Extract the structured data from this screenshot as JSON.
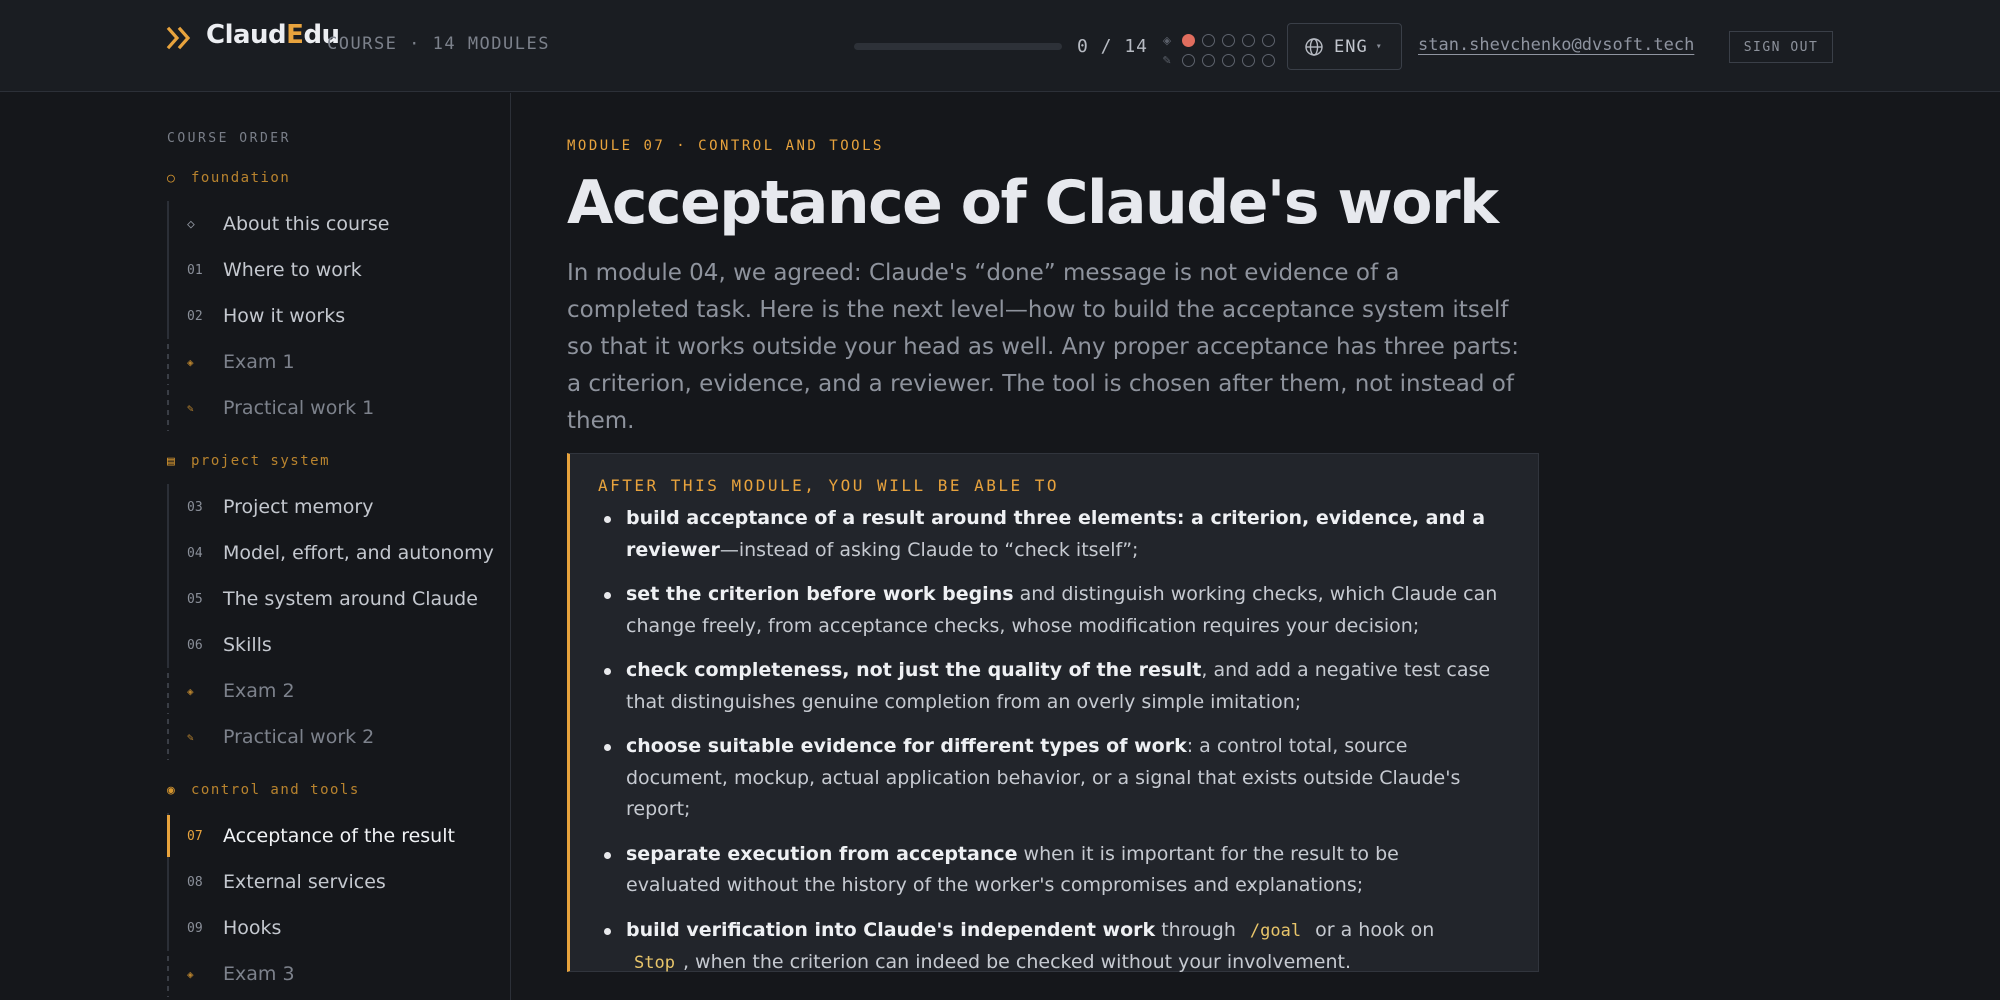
{
  "header": {
    "logo_main": "Claud",
    "logo_accent": "E",
    "logo_rest": "du",
    "course_meta": "COURSE · 14 MODULES",
    "progress_text": "0 / 14",
    "progress_fraction": 0,
    "dot_rows": [
      {
        "kind": "exam-icon",
        "states": [
          "done",
          "empty",
          "empty",
          "empty",
          "empty"
        ]
      },
      {
        "kind": "practice-icon",
        "states": [
          "empty",
          "empty",
          "empty",
          "empty",
          "empty"
        ]
      }
    ],
    "language": "ENG",
    "user_email": "stan.shevchenko@dvsoft.tech",
    "sign_out": "SIGN OUT",
    "accent_color": "#e8a33d"
  },
  "sidebar": {
    "title": "COURSE ORDER",
    "sections": [
      {
        "name": "foundation",
        "symbol": "○",
        "items": [
          {
            "num": "◇",
            "label": "About this course"
          },
          {
            "num": "01",
            "label": "Where to work"
          },
          {
            "num": "02",
            "label": "How it works"
          },
          {
            "num": "◈",
            "label": "Exam 1"
          },
          {
            "num": "✎",
            "label": "Practical work 1"
          }
        ]
      },
      {
        "name": "project system",
        "symbol": "▤",
        "items": [
          {
            "num": "03",
            "label": "Project memory"
          },
          {
            "num": "04",
            "label": "Model, effort, and autonomy"
          },
          {
            "num": "05",
            "label": "The system around Claude"
          },
          {
            "num": "06",
            "label": "Skills"
          },
          {
            "num": "◈",
            "label": "Exam 2"
          },
          {
            "num": "✎",
            "label": "Practical work 2"
          }
        ]
      },
      {
        "name": "control and tools",
        "symbol": "◉",
        "items": [
          {
            "num": "07",
            "label": "Acceptance of the result"
          },
          {
            "num": "08",
            "label": "External services"
          },
          {
            "num": "09",
            "label": "Hooks"
          },
          {
            "num": "◈",
            "label": "Exam 3"
          }
        ]
      }
    ]
  },
  "main": {
    "kicker": "MODULE 07 · CONTROL AND TOOLS",
    "title": "Acceptance of Claude's work",
    "intro": "In module 04, we agreed: Claude's “done” message is not evidence of a completed task. Here is the next level—how to build the acceptance system itself so that it works outside your head as well. Any proper acceptance has three parts: a criterion, evidence, and a reviewer. The tool is chosen after them, not instead of them.",
    "callout_title": "AFTER THIS MODULE, YOU WILL BE ABLE TO",
    "goals": [
      {
        "bold": "build acceptance of a result around three elements: a criterion, evidence, and a reviewer",
        "rest": "—instead of asking Claude to “check itself”;"
      },
      {
        "bold": "set the criterion before work begins",
        "rest": " and distinguish working checks, which Claude can change freely, from acceptance checks, whose modification requires your decision;"
      },
      {
        "bold": "check completeness, not just the quality of the result",
        "rest": ", and add a negative test case that distinguishes genuine completion from an overly simple imitation;"
      },
      {
        "bold": "choose suitable evidence for different types of work",
        "rest": ": a control total, source document, mockup, actual application behavior, or a signal that exists outside Claude's report;"
      },
      {
        "bold": "separate execution from acceptance",
        "rest": " when it is important for the result to be evaluated without the history of the worker's compromises and explanations;"
      },
      {
        "bold": "build verification into Claude's independent work",
        "pre_code": " through ",
        "code1": "/goal",
        "mid": " or a hook on ",
        "code2": "Stop",
        "rest": ", when the criterion can indeed be checked without your involvement."
      }
    ]
  }
}
